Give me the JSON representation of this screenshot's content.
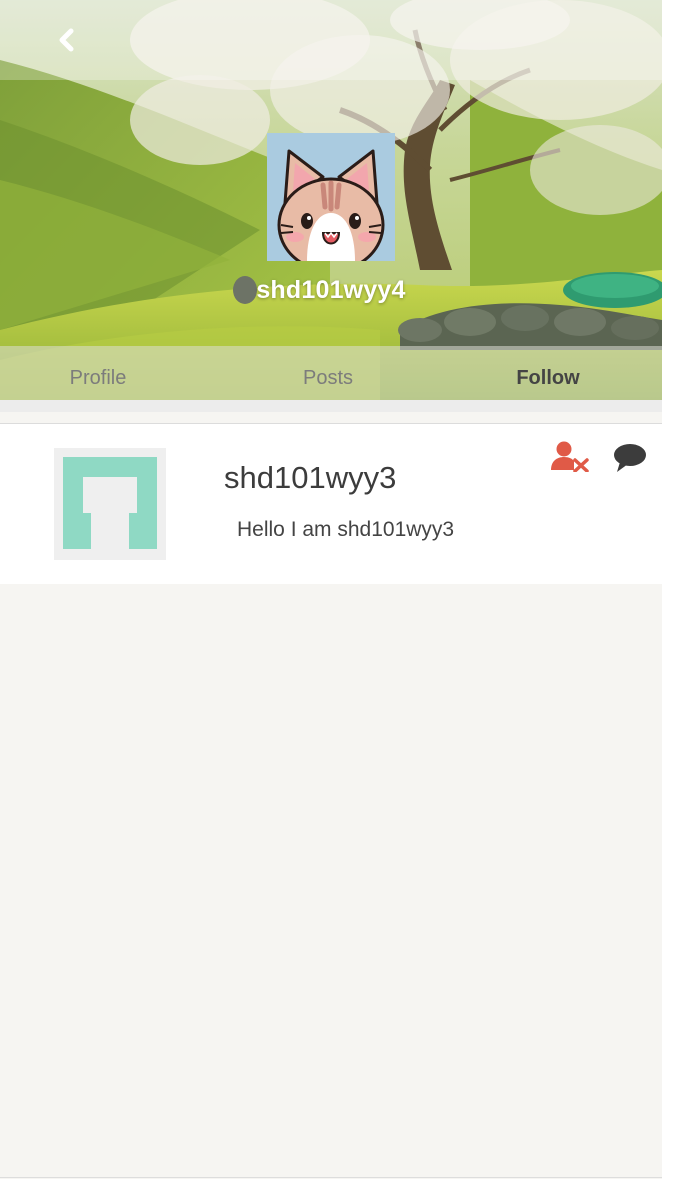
{
  "header": {
    "back_icon": "chevron-left-icon",
    "username": "shd101wyy4",
    "avatar": "cat-face-avatar"
  },
  "tabs": [
    {
      "label": "Profile",
      "active": false
    },
    {
      "label": "Posts",
      "active": false
    },
    {
      "label": "Follow",
      "active": true
    }
  ],
  "follow_list": [
    {
      "name": "shd101wyy3",
      "bio": "Hello I am shd101wyy3",
      "avatar": "identicon-teal",
      "actions": [
        "unfollow-user-icon",
        "chat-bubble-icon"
      ]
    }
  ],
  "colors": {
    "accent_unfollow": "#e05a47",
    "identicon": "#8fd9c4",
    "chat_icon": "#3c3c3c"
  }
}
